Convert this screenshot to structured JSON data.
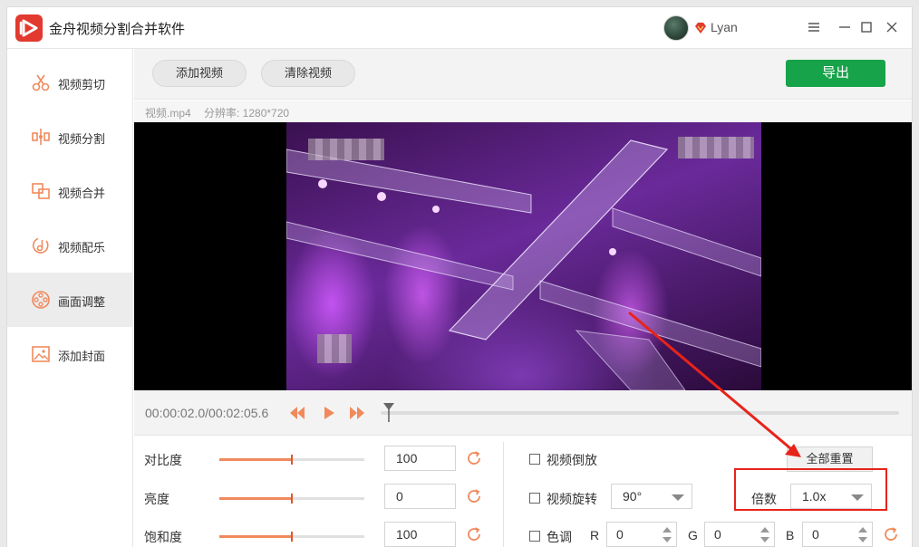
{
  "titlebar": {
    "app_title": "金舟视频分割合并软件",
    "username": "Lyan"
  },
  "sidebar": {
    "items": [
      {
        "label": "视频剪切",
        "icon": "scissors-icon"
      },
      {
        "label": "视频分割",
        "icon": "split-icon"
      },
      {
        "label": "视频合并",
        "icon": "merge-icon"
      },
      {
        "label": "视频配乐",
        "icon": "music-icon"
      },
      {
        "label": "画面调整",
        "icon": "film-reel-icon",
        "active": true
      },
      {
        "label": "添加封面",
        "icon": "image-icon"
      }
    ]
  },
  "toolbar": {
    "add_video_label": "添加视频",
    "clear_video_label": "清除视频",
    "export_label": "导出"
  },
  "fileinfo": {
    "filename": "视频.mp4",
    "resolution": "分辨率: 1280*720"
  },
  "playback": {
    "timecode": "00:00:02.0/00:02:05.6",
    "progress_fraction": 0.016
  },
  "adjust": {
    "contrast": {
      "label": "对比度",
      "value": "100",
      "slider_fraction": 0.5
    },
    "brightness": {
      "label": "亮度",
      "value": "0",
      "slider_fraction": 0.5
    },
    "saturation": {
      "label": "饱和度",
      "value": "100",
      "slider_fraction": 0.5
    }
  },
  "options": {
    "reverse_label": "视频倒放",
    "reset_all_label": "全部重置",
    "rotate_label": "视频旋转",
    "rotate_value": "90°",
    "speed_label": "倍数",
    "speed_value": "1.0x",
    "tone_label": "色调",
    "r_label": "R",
    "r_value": "0",
    "g_label": "G",
    "g_value": "0",
    "b_label": "B",
    "b_value": "0"
  },
  "colors": {
    "accent_orange": "#f08a5d",
    "export_green": "#16a34a",
    "annotation_red": "#e8231a",
    "logo_red": "#e23a2e"
  }
}
